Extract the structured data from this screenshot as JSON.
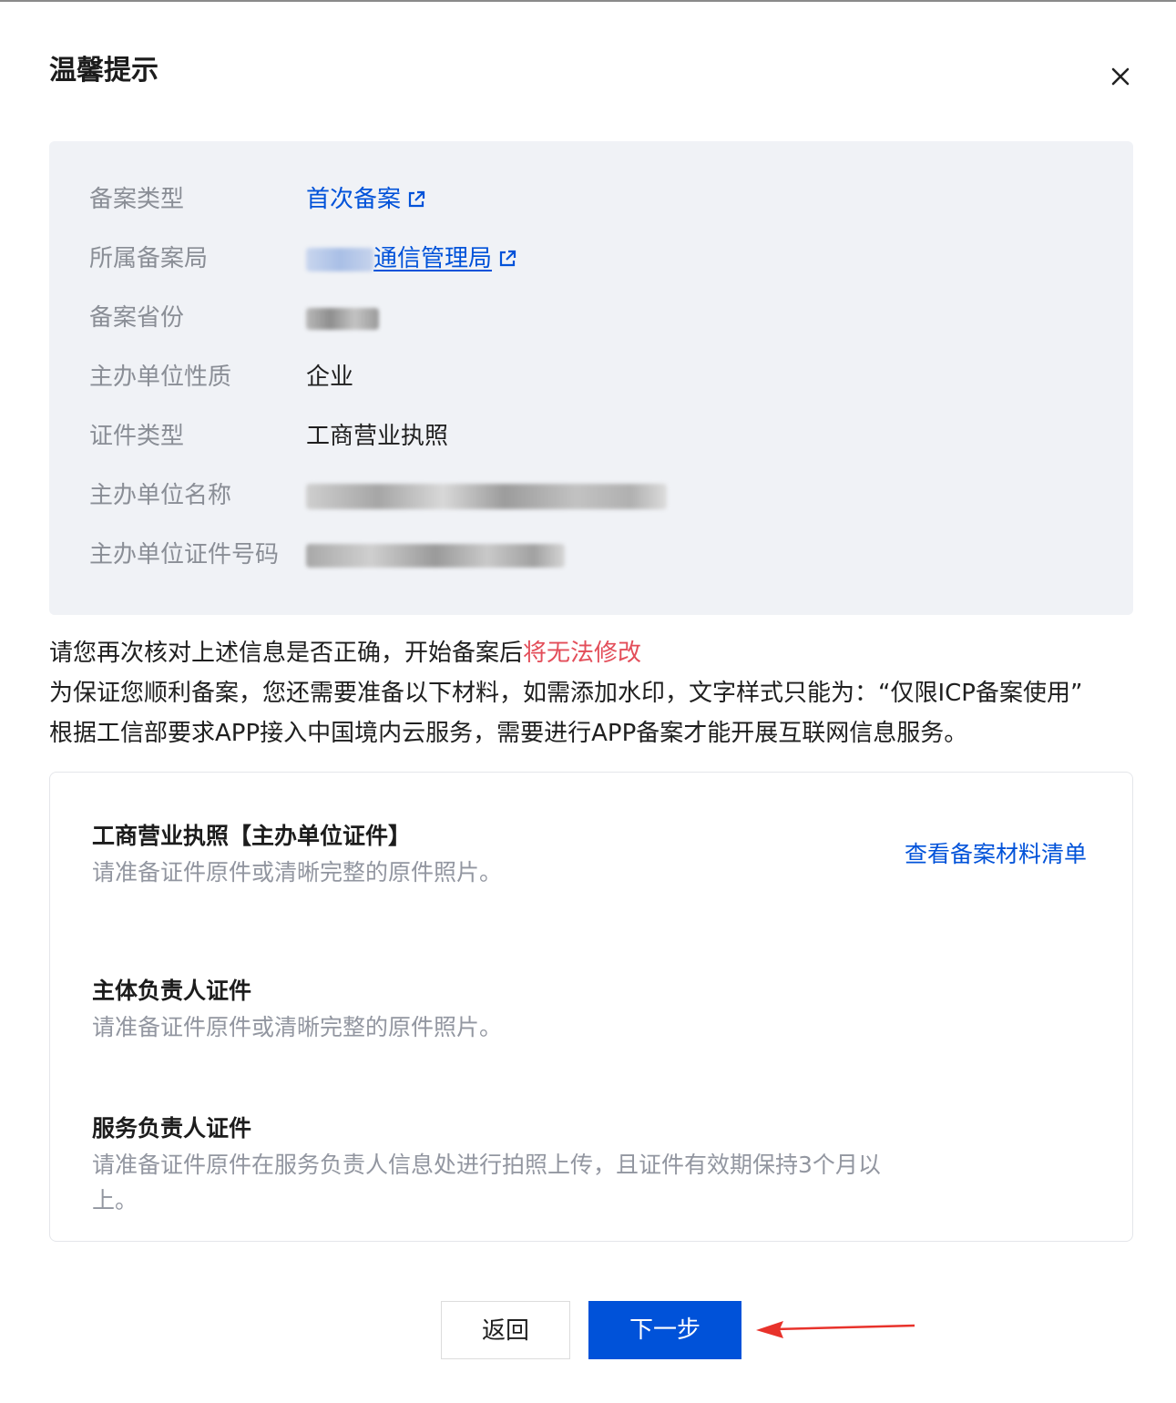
{
  "dialog": {
    "title": "温馨提示",
    "close_icon": "close-icon"
  },
  "info": {
    "rows": [
      {
        "label": "备案类型",
        "value": "首次备案",
        "link": true
      },
      {
        "label": "所属备案局",
        "value": "通信管理局",
        "link": true
      },
      {
        "label": "备案省份",
        "value": ""
      },
      {
        "label": "主办单位性质",
        "value": "企业"
      },
      {
        "label": "证件类型",
        "value": "工商营业执照"
      },
      {
        "label": "主办单位名称",
        "value": ""
      },
      {
        "label": "主办单位证件号码",
        "value": ""
      }
    ]
  },
  "notice": {
    "line1_prefix": "请您再次核对上述信息是否正确，开始备案后",
    "line1_warning": "将无法修改",
    "line2": "为保证您顺利备案，您还需要准备以下材料，如需添加水印，文字样式只能为：“仅限ICP备案使用”",
    "line3": "根据工信部要求APP接入中国境内云服务，需要进行APP备案才能开展互联网信息服务。"
  },
  "materials": {
    "link_label": "查看备案材料清单",
    "items": [
      {
        "title": "工商营业执照【主办单位证件】",
        "desc": "请准备证件原件或清晰完整的原件照片。"
      },
      {
        "title": "主体负责人证件",
        "desc": "请准备证件原件或清晰完整的原件照片。"
      },
      {
        "title": "服务负责人证件",
        "desc": "请准备证件原件在服务负责人信息处进行拍照上传，且证件有效期保持3个月以上。"
      }
    ]
  },
  "buttons": {
    "back": "返回",
    "next": "下一步"
  },
  "colors": {
    "primary": "#0052d9",
    "warning": "#e34d59",
    "panel_bg": "#f0f2f6",
    "annotation_arrow": "#e8322b"
  }
}
